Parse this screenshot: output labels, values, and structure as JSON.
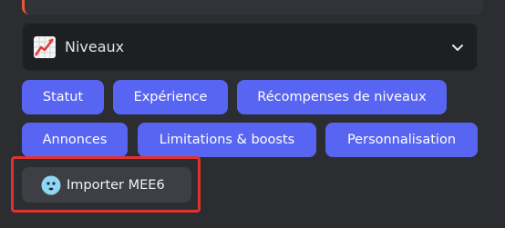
{
  "section_select": {
    "label": "Niveaux",
    "icon": "chart-increasing-icon"
  },
  "tabs": [
    {
      "label": "Statut"
    },
    {
      "label": "Expérience"
    },
    {
      "label": "Récompenses de niveaux"
    },
    {
      "label": "Annonces"
    },
    {
      "label": "Limitations & boosts"
    },
    {
      "label": "Personnalisation"
    }
  ],
  "import_button": {
    "label": "Importer MEE6",
    "icon": "mee6-face-icon"
  },
  "colors": {
    "background": "#2b2d31",
    "primary_button": "#5865f2",
    "secondary_button": "#3d3f45",
    "highlight_border": "#e0322e"
  }
}
